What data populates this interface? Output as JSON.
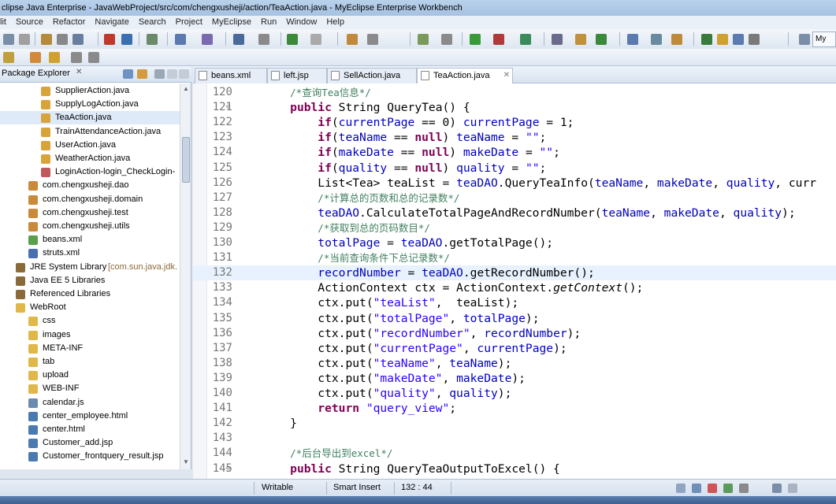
{
  "window": {
    "title": "clipse Java Enterprise - JavaWebProject/src/com/chengxusheji/action/TeaAction.java - MyEclipse Enterprise Workbench"
  },
  "menu": {
    "items": [
      "lit",
      "Source",
      "Refactor",
      "Navigate",
      "Search",
      "Project",
      "MyEclipse",
      "Run",
      "Window",
      "Help"
    ]
  },
  "toolbar": {
    "perspective_label": "My"
  },
  "package_explorer": {
    "title": "Package Explorer",
    "close_glyph": "✕",
    "items": [
      {
        "label": "SupplierAction.java",
        "icon": "java-file-icon",
        "extra": ""
      },
      {
        "label": "SupplyLogAction.java",
        "icon": "java-file-icon",
        "extra": ""
      },
      {
        "label": "TeaAction.java",
        "icon": "java-file-icon",
        "extra": ""
      },
      {
        "label": "TrainAttendanceAction.java",
        "icon": "java-file-icon",
        "extra": ""
      },
      {
        "label": "UserAction.java",
        "icon": "java-file-icon",
        "extra": ""
      },
      {
        "label": "WeatherAction.java",
        "icon": "java-file-icon",
        "extra": ""
      },
      {
        "label": "LoginAction-login_CheckLogin-",
        "icon": "xml-file-icon",
        "extra": ""
      },
      {
        "label": "com.chengxusheji.dao",
        "icon": "package-icon",
        "extra": ""
      },
      {
        "label": "com.chengxusheji.domain",
        "icon": "package-icon",
        "extra": ""
      },
      {
        "label": "com.chengxusheji.test",
        "icon": "package-icon",
        "extra": ""
      },
      {
        "label": "com.chengxusheji.utils",
        "icon": "package-icon",
        "extra": ""
      },
      {
        "label": "beans.xml",
        "icon": "bean-icon",
        "extra": ""
      },
      {
        "label": "struts.xml",
        "icon": "gear-icon",
        "extra": ""
      },
      {
        "label": "JRE System Library",
        "icon": "library-icon",
        "extra": "[com.sun.java.jdk."
      },
      {
        "label": "Java EE 5 Libraries",
        "icon": "library-icon",
        "extra": ""
      },
      {
        "label": "Referenced Libraries",
        "icon": "library-icon",
        "extra": ""
      },
      {
        "label": "WebRoot",
        "icon": "folder-icon",
        "extra": ""
      },
      {
        "label": "css",
        "icon": "folder-icon",
        "extra": ""
      },
      {
        "label": "images",
        "icon": "folder-icon",
        "extra": ""
      },
      {
        "label": "META-INF",
        "icon": "folder-icon",
        "extra": ""
      },
      {
        "label": "tab",
        "icon": "folder-icon",
        "extra": ""
      },
      {
        "label": "upload",
        "icon": "folder-icon",
        "extra": ""
      },
      {
        "label": "WEB-INF",
        "icon": "folder-icon",
        "extra": ""
      },
      {
        "label": "calendar.js",
        "icon": "js-file-icon",
        "extra": ""
      },
      {
        "label": "center_employee.html",
        "icon": "html-file-icon",
        "extra": ""
      },
      {
        "label": "center.html",
        "icon": "html-file-icon",
        "extra": ""
      },
      {
        "label": "Customer_add.jsp",
        "icon": "jsp-file-icon",
        "extra": ""
      },
      {
        "label": "Customer_frontquery_result.jsp",
        "icon": "jsp-file-icon",
        "extra": ""
      }
    ]
  },
  "editor": {
    "tabs": [
      {
        "label": "beans.xml",
        "active": false
      },
      {
        "label": "left.jsp",
        "active": false
      },
      {
        "label": "SellAction.java",
        "active": false
      },
      {
        "label": "TeaAction.java",
        "active": true
      }
    ],
    "tab_close_glyph": "✕",
    "current_line": "132",
    "lines": [
      {
        "num": "120",
        "text": "    /*查询Tea信息*/"
      },
      {
        "num": "121",
        "text": "    public String QueryTea() {"
      },
      {
        "num": "122",
        "text": "        if(currentPage == 0) currentPage = 1;"
      },
      {
        "num": "123",
        "text": "        if(teaName == null) teaName = \"\";"
      },
      {
        "num": "124",
        "text": "        if(makeDate == null) makeDate = \"\";"
      },
      {
        "num": "125",
        "text": "        if(quality == null) quality = \"\";"
      },
      {
        "num": "126",
        "text": "        List<Tea> teaList = teaDAO.QueryTeaInfo(teaName, makeDate, quality, curr"
      },
      {
        "num": "127",
        "text": "        /*计算总的页数和总的记录数*/"
      },
      {
        "num": "128",
        "text": "        teaDAO.CalculateTotalPageAndRecordNumber(teaName, makeDate, quality);"
      },
      {
        "num": "129",
        "text": "        /*获取到总的页码数目*/"
      },
      {
        "num": "130",
        "text": "        totalPage = teaDAO.getTotalPage();"
      },
      {
        "num": "131",
        "text": "        /*当前查询条件下总记录数*/"
      },
      {
        "num": "132",
        "text": "        recordNumber = teaDAO.getRecordNumber();"
      },
      {
        "num": "133",
        "text": "        ActionContext ctx = ActionContext.getContext();"
      },
      {
        "num": "134",
        "text": "        ctx.put(\"teaList\",  teaList);"
      },
      {
        "num": "135",
        "text": "        ctx.put(\"totalPage\", totalPage);"
      },
      {
        "num": "136",
        "text": "        ctx.put(\"recordNumber\", recordNumber);"
      },
      {
        "num": "137",
        "text": "        ctx.put(\"currentPage\", currentPage);"
      },
      {
        "num": "138",
        "text": "        ctx.put(\"teaName\", teaName);"
      },
      {
        "num": "139",
        "text": "        ctx.put(\"makeDate\", makeDate);"
      },
      {
        "num": "140",
        "text": "        ctx.put(\"quality\", quality);"
      },
      {
        "num": "141",
        "text": "        return \"query_view\";"
      },
      {
        "num": "142",
        "text": "    }"
      },
      {
        "num": "143",
        "text": ""
      },
      {
        "num": "144",
        "text": "    /*后台导出到excel*/"
      },
      {
        "num": "145",
        "text": "    public String QueryTeaOutputToExcel() {"
      }
    ]
  },
  "status": {
    "writable": "Writable",
    "insert_mode": "Smart Insert",
    "position": "132 : 44"
  },
  "colors": {
    "keyword": "#7f0055",
    "string": "#2a00ff",
    "comment": "#3f7f5f",
    "field": "#0000c0",
    "current_line": "#e8f2fe"
  }
}
